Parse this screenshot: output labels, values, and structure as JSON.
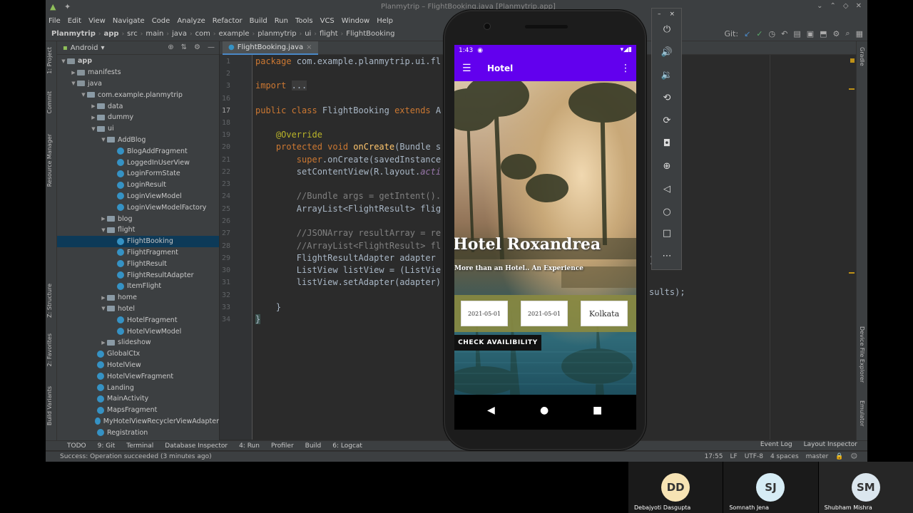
{
  "window": {
    "title": "Planmytrip – FlightBooking.java [Planmytrip.app]"
  },
  "menu": [
    "File",
    "Edit",
    "View",
    "Navigate",
    "Code",
    "Analyze",
    "Refactor",
    "Build",
    "Run",
    "Tools",
    "VCS",
    "Window",
    "Help"
  ],
  "breadcrumb": [
    "Planmytrip",
    "app",
    "src",
    "main",
    "java",
    "com",
    "example",
    "planmytrip",
    "ui",
    "flight",
    "FlightBooking"
  ],
  "git_label": "Git:",
  "project_panel": {
    "view": "Android"
  },
  "tree": [
    {
      "label": "app",
      "level": 0,
      "type": "folder",
      "arrow": "▼",
      "bold": true
    },
    {
      "label": "manifests",
      "level": 1,
      "type": "folder",
      "arrow": "▶"
    },
    {
      "label": "java",
      "level": 1,
      "type": "folder",
      "arrow": "▼"
    },
    {
      "label": "com.example.planmytrip",
      "level": 2,
      "type": "pkg",
      "arrow": "▼"
    },
    {
      "label": "data",
      "level": 3,
      "type": "pkg",
      "arrow": "▶"
    },
    {
      "label": "dummy",
      "level": 3,
      "type": "pkg",
      "arrow": "▶"
    },
    {
      "label": "ui",
      "level": 3,
      "type": "pkg",
      "arrow": "▼"
    },
    {
      "label": "AddBlog",
      "level": 4,
      "type": "pkg",
      "arrow": "▼"
    },
    {
      "label": "BlogAddFragment",
      "level": 5,
      "type": "class",
      "arrow": ""
    },
    {
      "label": "LoggedInUserView",
      "level": 5,
      "type": "class",
      "arrow": ""
    },
    {
      "label": "LoginFormState",
      "level": 5,
      "type": "class",
      "arrow": ""
    },
    {
      "label": "LoginResult",
      "level": 5,
      "type": "class",
      "arrow": ""
    },
    {
      "label": "LoginViewModel",
      "level": 5,
      "type": "class",
      "arrow": ""
    },
    {
      "label": "LoginViewModelFactory",
      "level": 5,
      "type": "class",
      "arrow": ""
    },
    {
      "label": "blog",
      "level": 4,
      "type": "pkg",
      "arrow": "▶"
    },
    {
      "label": "flight",
      "level": 4,
      "type": "pkg",
      "arrow": "▼"
    },
    {
      "label": "FlightBooking",
      "level": 5,
      "type": "class",
      "arrow": "",
      "selected": true
    },
    {
      "label": "FlightFragment",
      "level": 5,
      "type": "class",
      "arrow": ""
    },
    {
      "label": "FlightResult",
      "level": 5,
      "type": "class",
      "arrow": ""
    },
    {
      "label": "FlightResultAdapter",
      "level": 5,
      "type": "class",
      "arrow": ""
    },
    {
      "label": "ItemFlight",
      "level": 5,
      "type": "class",
      "arrow": ""
    },
    {
      "label": "home",
      "level": 4,
      "type": "pkg",
      "arrow": "▶"
    },
    {
      "label": "hotel",
      "level": 4,
      "type": "pkg",
      "arrow": "▼"
    },
    {
      "label": "HotelFragment",
      "level": 5,
      "type": "class",
      "arrow": ""
    },
    {
      "label": "HotelViewModel",
      "level": 5,
      "type": "class",
      "arrow": ""
    },
    {
      "label": "slideshow",
      "level": 4,
      "type": "pkg",
      "arrow": "▶"
    },
    {
      "label": "GlobalCtx",
      "level": 3,
      "type": "class",
      "arrow": ""
    },
    {
      "label": "HotelView",
      "level": 3,
      "type": "class",
      "arrow": ""
    },
    {
      "label": "HotelViewFragment",
      "level": 3,
      "type": "class",
      "arrow": ""
    },
    {
      "label": "Landing",
      "level": 3,
      "type": "class",
      "arrow": ""
    },
    {
      "label": "MainActivity",
      "level": 3,
      "type": "class",
      "arrow": ""
    },
    {
      "label": "MapsFragment",
      "level": 3,
      "type": "class",
      "arrow": ""
    },
    {
      "label": "MyHotelViewRecyclerViewAdapter",
      "level": 3,
      "type": "class",
      "arrow": ""
    },
    {
      "label": "Registration",
      "level": 3,
      "type": "class",
      "arrow": ""
    }
  ],
  "editor": {
    "tab": "FlightBooking.java",
    "line_numbers": [
      "1",
      "2",
      "3",
      "16",
      "17",
      "18",
      "19",
      "20",
      "21",
      "22",
      "23",
      "24",
      "25",
      "26",
      "27",
      "28",
      "29",
      "30",
      "31",
      "32",
      "33",
      "34"
    ],
    "trailing_right": [
      ")",
      ";",
      "sults);"
    ]
  },
  "side_tabs_left": [
    "1: Project",
    "Commit",
    "Resource Manager",
    "Z: Structure",
    "2: Favorites",
    "Build Variants"
  ],
  "side_tabs_right": [
    "Gradle",
    "Device File Explorer",
    "Emulator"
  ],
  "bottom_tools": [
    "TODO",
    "9: Git",
    "Terminal",
    "Database Inspector",
    "4: Run",
    "Profiler",
    "Build",
    "6: Logcat"
  ],
  "bottom_tools_right": [
    "Event Log",
    "Layout Inspector"
  ],
  "status": {
    "message": "Success: Operation succeeded (3 minutes ago)",
    "position": "17:55",
    "line_sep": "LF",
    "encoding": "UTF-8",
    "indent": "4 spaces",
    "branch": "master"
  },
  "phone": {
    "time": "1:43",
    "appbar_title": "Hotel",
    "hotel_name": "Hotel Roxandrea",
    "tagline": "More than an Hotel.. An Experience",
    "date_from": "2021-05-01",
    "date_to": "2021-05-01",
    "city": "Kolkata",
    "check_button": "CHECK AVAILIBILITY"
  },
  "participants": [
    {
      "initials": "DD",
      "name": "Debajyoti Dasgupta",
      "color": "#f6e3b4"
    },
    {
      "initials": "SJ",
      "name": "Somnath Jena",
      "color": "#d6ecf5"
    },
    {
      "initials": "SM",
      "name": "Shubham Mishra",
      "color": "#dbe6ee"
    }
  ]
}
